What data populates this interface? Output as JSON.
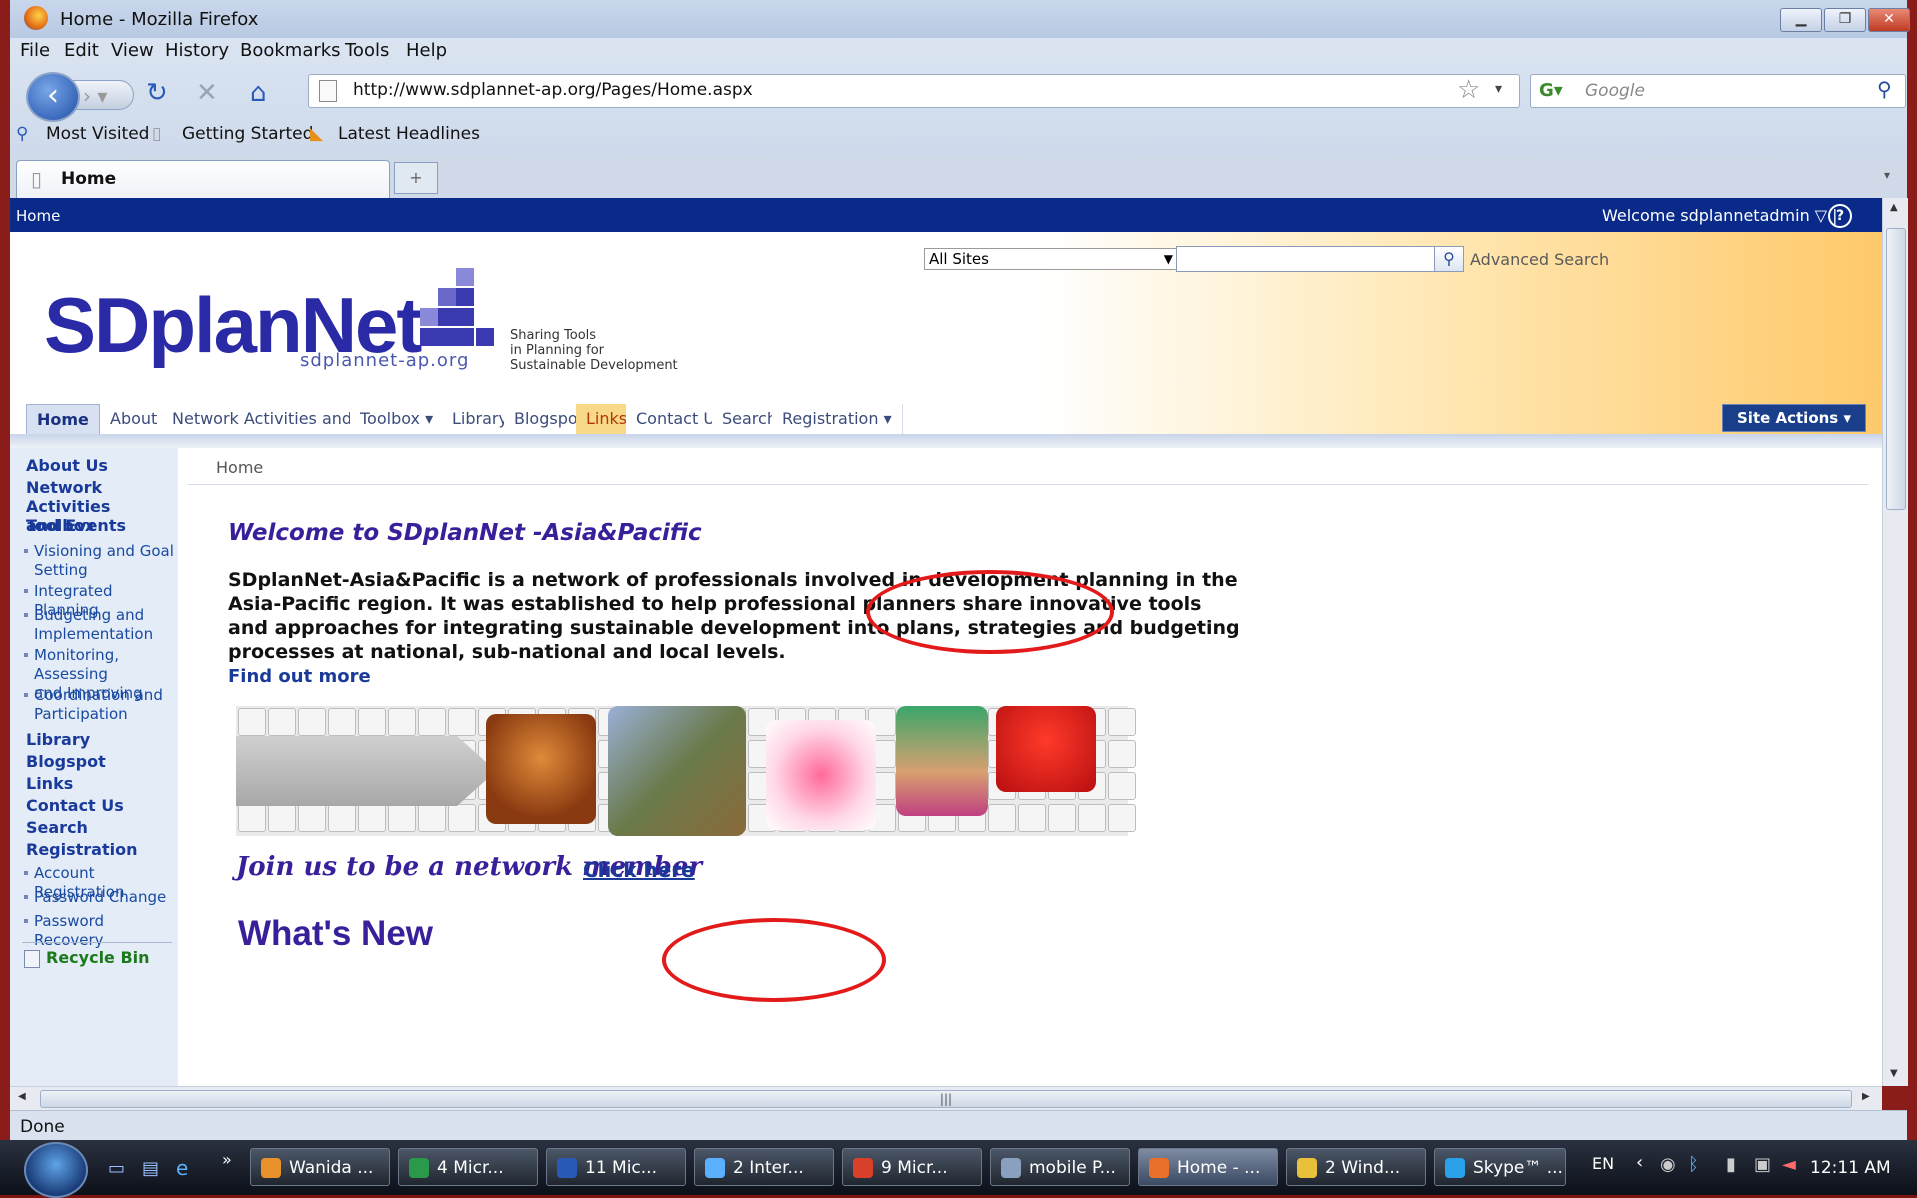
{
  "window": {
    "title": "Home - Mozilla Firefox"
  },
  "menu": [
    "File",
    "Edit",
    "View",
    "History",
    "Bookmarks",
    "Tools",
    "Help"
  ],
  "address": {
    "url": "http://www.sdplannet-ap.org/Pages/Home.aspx"
  },
  "search_engine": {
    "placeholder": "Google"
  },
  "bookmarks": [
    "Most Visited",
    "Getting Started",
    "Latest Headlines"
  ],
  "tab": {
    "label": "Home"
  },
  "sp": {
    "topbar_home": "Home",
    "welcome": "Welcome sdplannetadmin ▽ |",
    "scope": "All Sites",
    "advanced_search": "Advanced Search",
    "site_actions": "Site Actions ▾",
    "logo_text": "SDplanNet",
    "logo_url": "sdplannet-ap.org",
    "logo_tagline": [
      "Sharing Tools",
      "in Planning for",
      "Sustainable Development"
    ]
  },
  "topnav": [
    "Home",
    "About Us",
    "Network Activities and Events",
    "Toolbox ▾",
    "Library",
    "Blogspot",
    "Links",
    "Contact Us",
    "Search",
    "Registration ▾"
  ],
  "leftnav": {
    "about": "About Us",
    "network": [
      "Network Activities",
      "and Events"
    ],
    "toolbox": "Toolbox",
    "toolbox_items": [
      [
        "Visioning and Goal",
        "Setting"
      ],
      [
        "Integrated Planning"
      ],
      [
        "Budgeting and",
        "Implementation"
      ],
      [
        "Monitoring, Assessing",
        "and Improving"
      ],
      [
        "Coordination and",
        "Participation"
      ]
    ],
    "library": "Library",
    "blogspot": "Blogspot",
    "links": "Links",
    "contact": "Contact Us",
    "search": "Search",
    "registration": "Registration",
    "registration_items": [
      "Account Registration",
      "Password Change",
      "Password Recovery"
    ],
    "recycle": "Recycle Bin"
  },
  "main": {
    "breadcrumb": "Home",
    "welcome_title": "Welcome to SDplanNet -Asia&Pacific",
    "intro": "SDplanNet-Asia&Pacific is a network of professionals involved in development planning in the Asia-Pacific region. It was established to help professional planners share innovative tools and approaches for integrating sustainable development into plans, strategies and budgeting processes at national, sub-national and local levels.",
    "find_out_more": "Find out more",
    "join": "Join us to be a network member",
    "click_here": "Click here",
    "whats_new": "What's New"
  },
  "status": "Done",
  "taskbar": {
    "items": [
      "Wanida ...",
      "4 Micr...",
      "11 Mic...",
      "2 Inter...",
      "9 Micr...",
      "mobile P...",
      "Home - ...",
      "2 Wind...",
      "Skype™ ..."
    ],
    "lang": "EN",
    "clock": "12:11 AM"
  },
  "colors": {
    "sp_topbar": "#0a2a8a",
    "brand": "#2b2aa6",
    "heading": "#3a1f9a",
    "annotation": "#e21a1a"
  }
}
